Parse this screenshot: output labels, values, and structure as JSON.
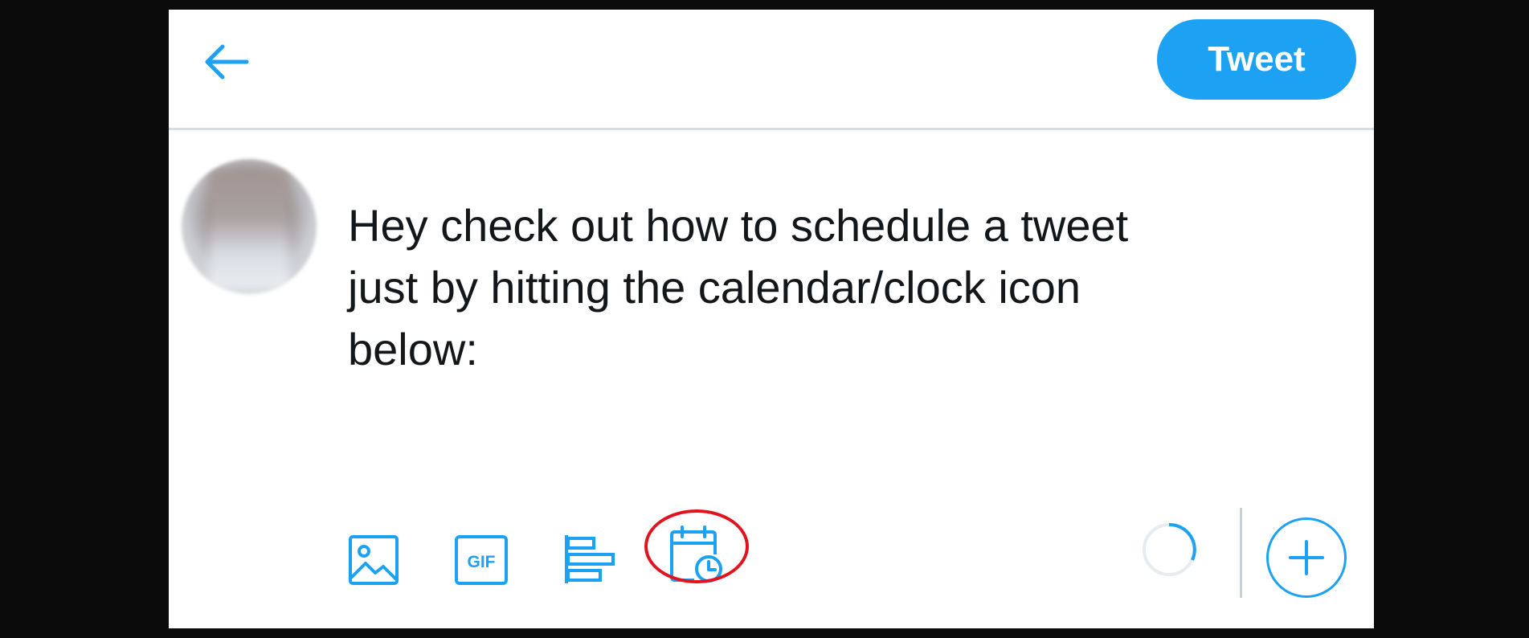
{
  "header": {
    "back_icon": "arrow-left-icon",
    "tweet_button_label": "Tweet"
  },
  "composer": {
    "avatar": "user-avatar-blurred",
    "text": "Hey check out how to schedule a tweet\njust by hitting the calendar/clock icon\nbelow:"
  },
  "toolbar": {
    "icons": [
      "image-icon",
      "gif-icon",
      "poll-icon",
      "schedule-icon"
    ],
    "gif_label": "GIF",
    "highlight": "schedule-icon"
  },
  "footer": {
    "counter_icon": "character-counter-ring",
    "add_icon": "plus-icon"
  },
  "colors": {
    "accent": "#1da1f2",
    "highlight": "#e0141e",
    "text": "#14171a",
    "divider": "#d3dde4"
  }
}
